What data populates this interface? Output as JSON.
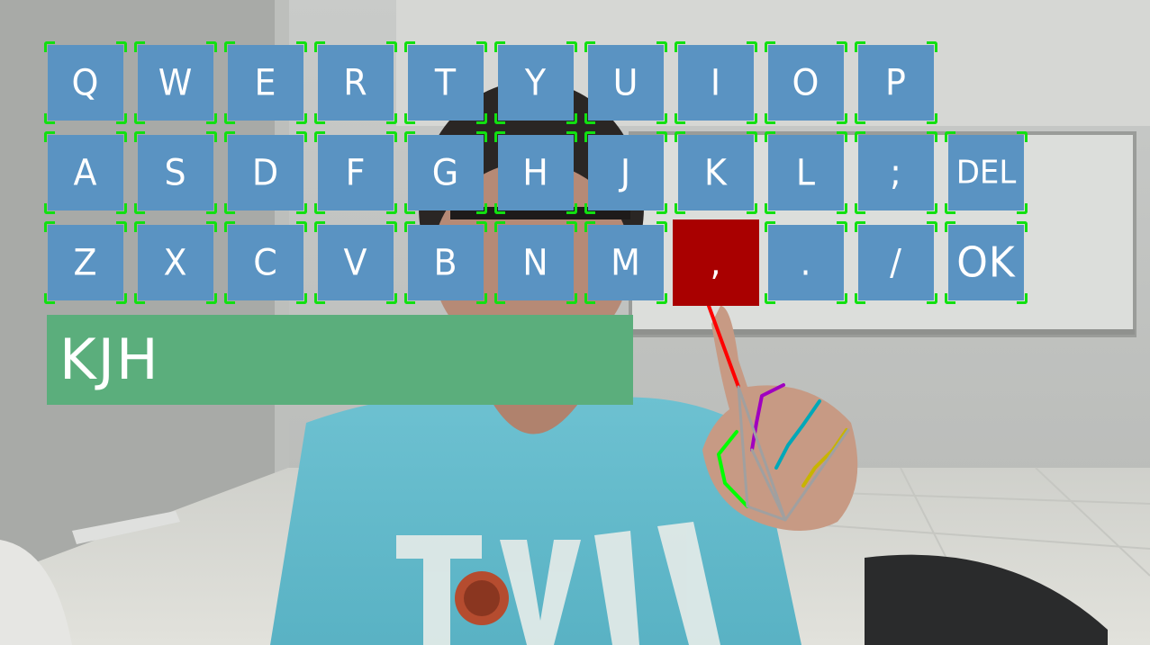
{
  "keyboard": {
    "rows": [
      [
        "Q",
        "W",
        "E",
        "R",
        "T",
        "Y",
        "U",
        "I",
        "O",
        "P"
      ],
      [
        "A",
        "S",
        "D",
        "F",
        "G",
        "H",
        "J",
        "K",
        "L",
        ";",
        "DEL"
      ],
      [
        "Z",
        "X",
        "C",
        "V",
        "B",
        "N",
        "M",
        ",",
        ".",
        "/",
        "OK"
      ]
    ],
    "active_key": ",",
    "colors": {
      "key_fill": "#5a93c2",
      "key_text": "#ffffff",
      "corner_marks": "#11e011",
      "active_key_fill": "#a90000"
    }
  },
  "text_box": {
    "value": "KJH",
    "background": "#5bae7c"
  },
  "hand_landmarks": {
    "colors": {
      "index_pointer": "#ff0000",
      "thumb": "#00ff00",
      "middle": "#a000c0",
      "ring": "#00a8b8",
      "pinky": "#c8b400",
      "palm": "#a0a0a0"
    }
  }
}
